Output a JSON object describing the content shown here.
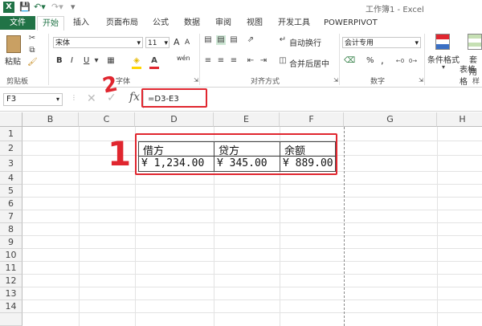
{
  "window": {
    "title": "工作簿1 - Excel",
    "app_icon": "X"
  },
  "tabs": [
    "文件",
    "开始",
    "插入",
    "页面布局",
    "公式",
    "数据",
    "审阅",
    "视图",
    "开发工具",
    "POWERPIVOT"
  ],
  "ribbon": {
    "clipboard": {
      "paste": "粘贴",
      "group": "剪贴板"
    },
    "font": {
      "name": "宋体",
      "size": "11",
      "bold": "B",
      "italic": "I",
      "underline": "U",
      "grow": "A",
      "shrink": "A",
      "wen": "wén",
      "group": "字体"
    },
    "alignment": {
      "wrap": "自动换行",
      "merge": "合并后居中",
      "group": "对齐方式"
    },
    "number": {
      "format": "会计专用",
      "percent": "%",
      "comma": ",",
      "group": "数字"
    },
    "styles": {
      "conditional": "条件格式",
      "table": "套用",
      "table2": "表格格",
      "group": "样"
    }
  },
  "formula_bar": {
    "name_box": "F3",
    "fx": "fx",
    "formula": "=D3-E3"
  },
  "sheet": {
    "columns": [
      "B",
      "C",
      "D",
      "E",
      "F",
      "G",
      "H"
    ],
    "rows": [
      "1",
      "2",
      "3",
      "4",
      "5",
      "6",
      "7",
      "8",
      "9",
      "10",
      "11",
      "12",
      "13",
      "14"
    ],
    "cells": {
      "D2": "借方",
      "E2": "贷方",
      "F2": "余额",
      "D3": "¥  1,234.00",
      "E3": "¥ 345.00",
      "F3": "¥ 889.00"
    }
  },
  "annotations": {
    "one": "1",
    "two": "2"
  },
  "colors": {
    "excel_green": "#217346",
    "annotation_red": "#e0262f"
  }
}
